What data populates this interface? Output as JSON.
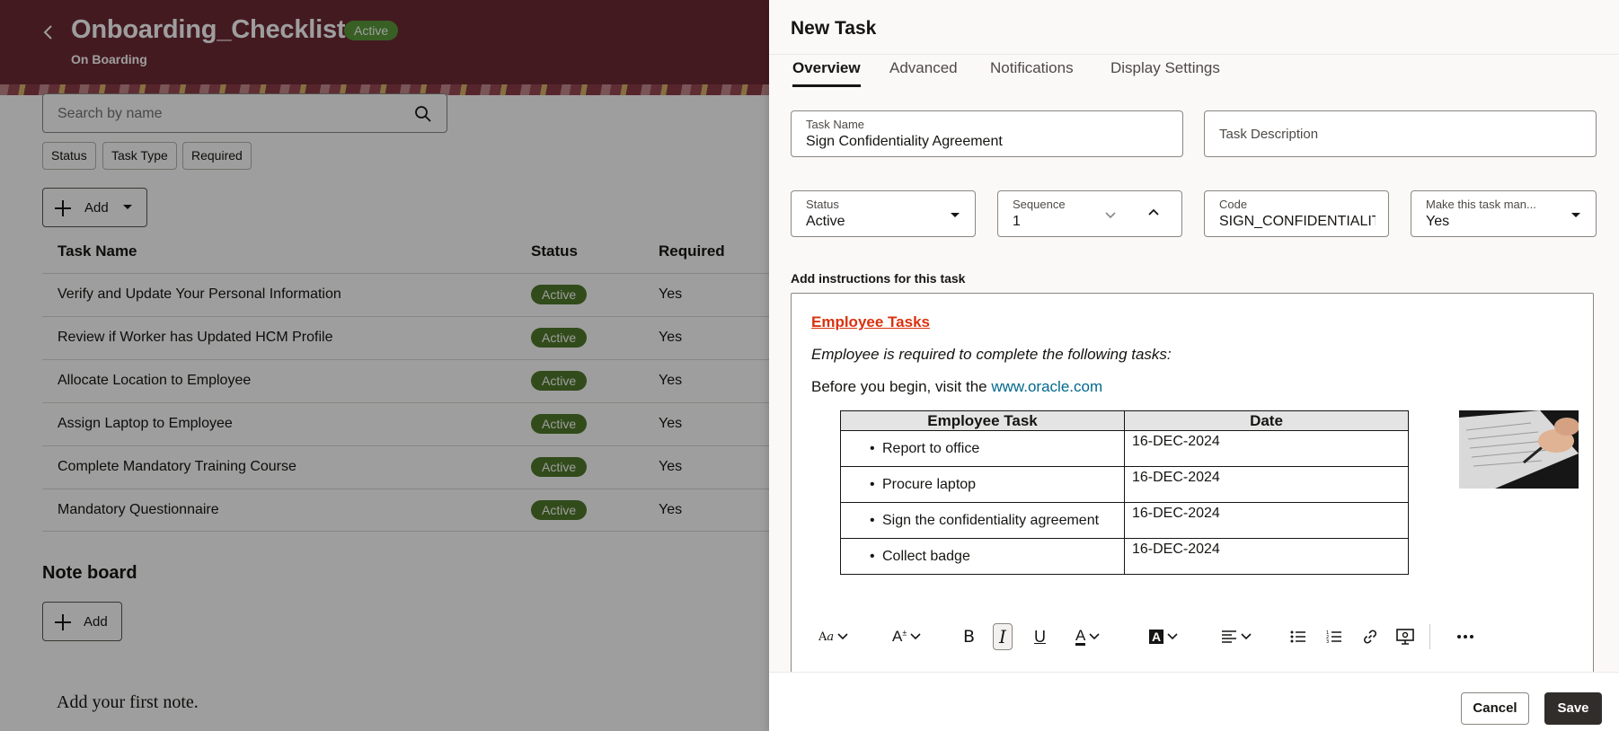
{
  "page": {
    "title": "Onboarding_Checklist",
    "status_badge": "Active",
    "subtitle": "On Boarding",
    "search_placeholder": "Search by name",
    "filters": [
      "Status",
      "Task Type",
      "Required"
    ],
    "add_label": "Add",
    "columns": {
      "name": "Task Name",
      "status": "Status",
      "required": "Required"
    },
    "tasks": [
      {
        "name": "Verify and Update Your Personal Information",
        "status": "Active",
        "required": "Yes"
      },
      {
        "name": "Review if Worker has Updated HCM Profile",
        "status": "Active",
        "required": "Yes"
      },
      {
        "name": "Allocate Location to Employee",
        "status": "Active",
        "required": "Yes"
      },
      {
        "name": "Assign Laptop to Employee",
        "status": "Active",
        "required": "Yes"
      },
      {
        "name": "Complete Mandatory Training Course",
        "status": "Active",
        "required": "Yes"
      },
      {
        "name": "Mandatory Questionnaire",
        "status": "Active",
        "required": "Yes"
      }
    ],
    "note_board": {
      "heading": "Note board",
      "add_label": "Add",
      "empty_text": "Add your first note."
    }
  },
  "drawer": {
    "title": "New Task",
    "tabs": [
      "Overview",
      "Advanced",
      "Notifications",
      "Display Settings"
    ],
    "active_tab": "Overview",
    "fields": {
      "task_name": {
        "label": "Task Name",
        "value": "Sign Confidentiality Agreement"
      },
      "task_description": {
        "placeholder": "Task Description"
      },
      "status": {
        "label": "Status",
        "value": "Active"
      },
      "sequence": {
        "label": "Sequence",
        "value": "1"
      },
      "code": {
        "label": "Code",
        "value": "SIGN_CONFIDENTIALITY_AGREEMENT"
      },
      "mandatory": {
        "label": "Make this task man...",
        "value": "Yes"
      }
    },
    "instructions_label": "Add instructions for this task",
    "editor": {
      "heading": "Employee Tasks",
      "intro": "Employee is required to complete the following tasks:",
      "visit_prefix": "Before you begin, visit the",
      "link": "www.oracle.com",
      "table_headers": [
        "Employee Task",
        "Date"
      ],
      "rows": [
        {
          "task": "Report to office",
          "date": "16-DEC-2024"
        },
        {
          "task": "Procure laptop",
          "date": "16-DEC-2024"
        },
        {
          "task": "Sign the confidentiality agreement",
          "date": "16-DEC-2024"
        },
        {
          "task": "Collect badge",
          "date": "16-DEC-2024"
        }
      ],
      "image_icon": "signing-document-image"
    },
    "toolbar_icons": [
      "font-family-icon",
      "font-size-icon",
      "bold-icon",
      "italic-icon",
      "underline-icon",
      "text-color-icon",
      "highlight-color-icon",
      "align-icon",
      "bullet-list-icon",
      "numbered-list-icon",
      "link-icon",
      "insert-image-icon",
      "more-icon"
    ],
    "cancel_label": "Cancel",
    "save_label": "Save"
  },
  "colors": {
    "hero": "#6f2a36",
    "badge_green": "#5b9a3a",
    "heading_red": "#d9320f",
    "link_teal": "#00688c",
    "save_button": "#312d2a"
  }
}
